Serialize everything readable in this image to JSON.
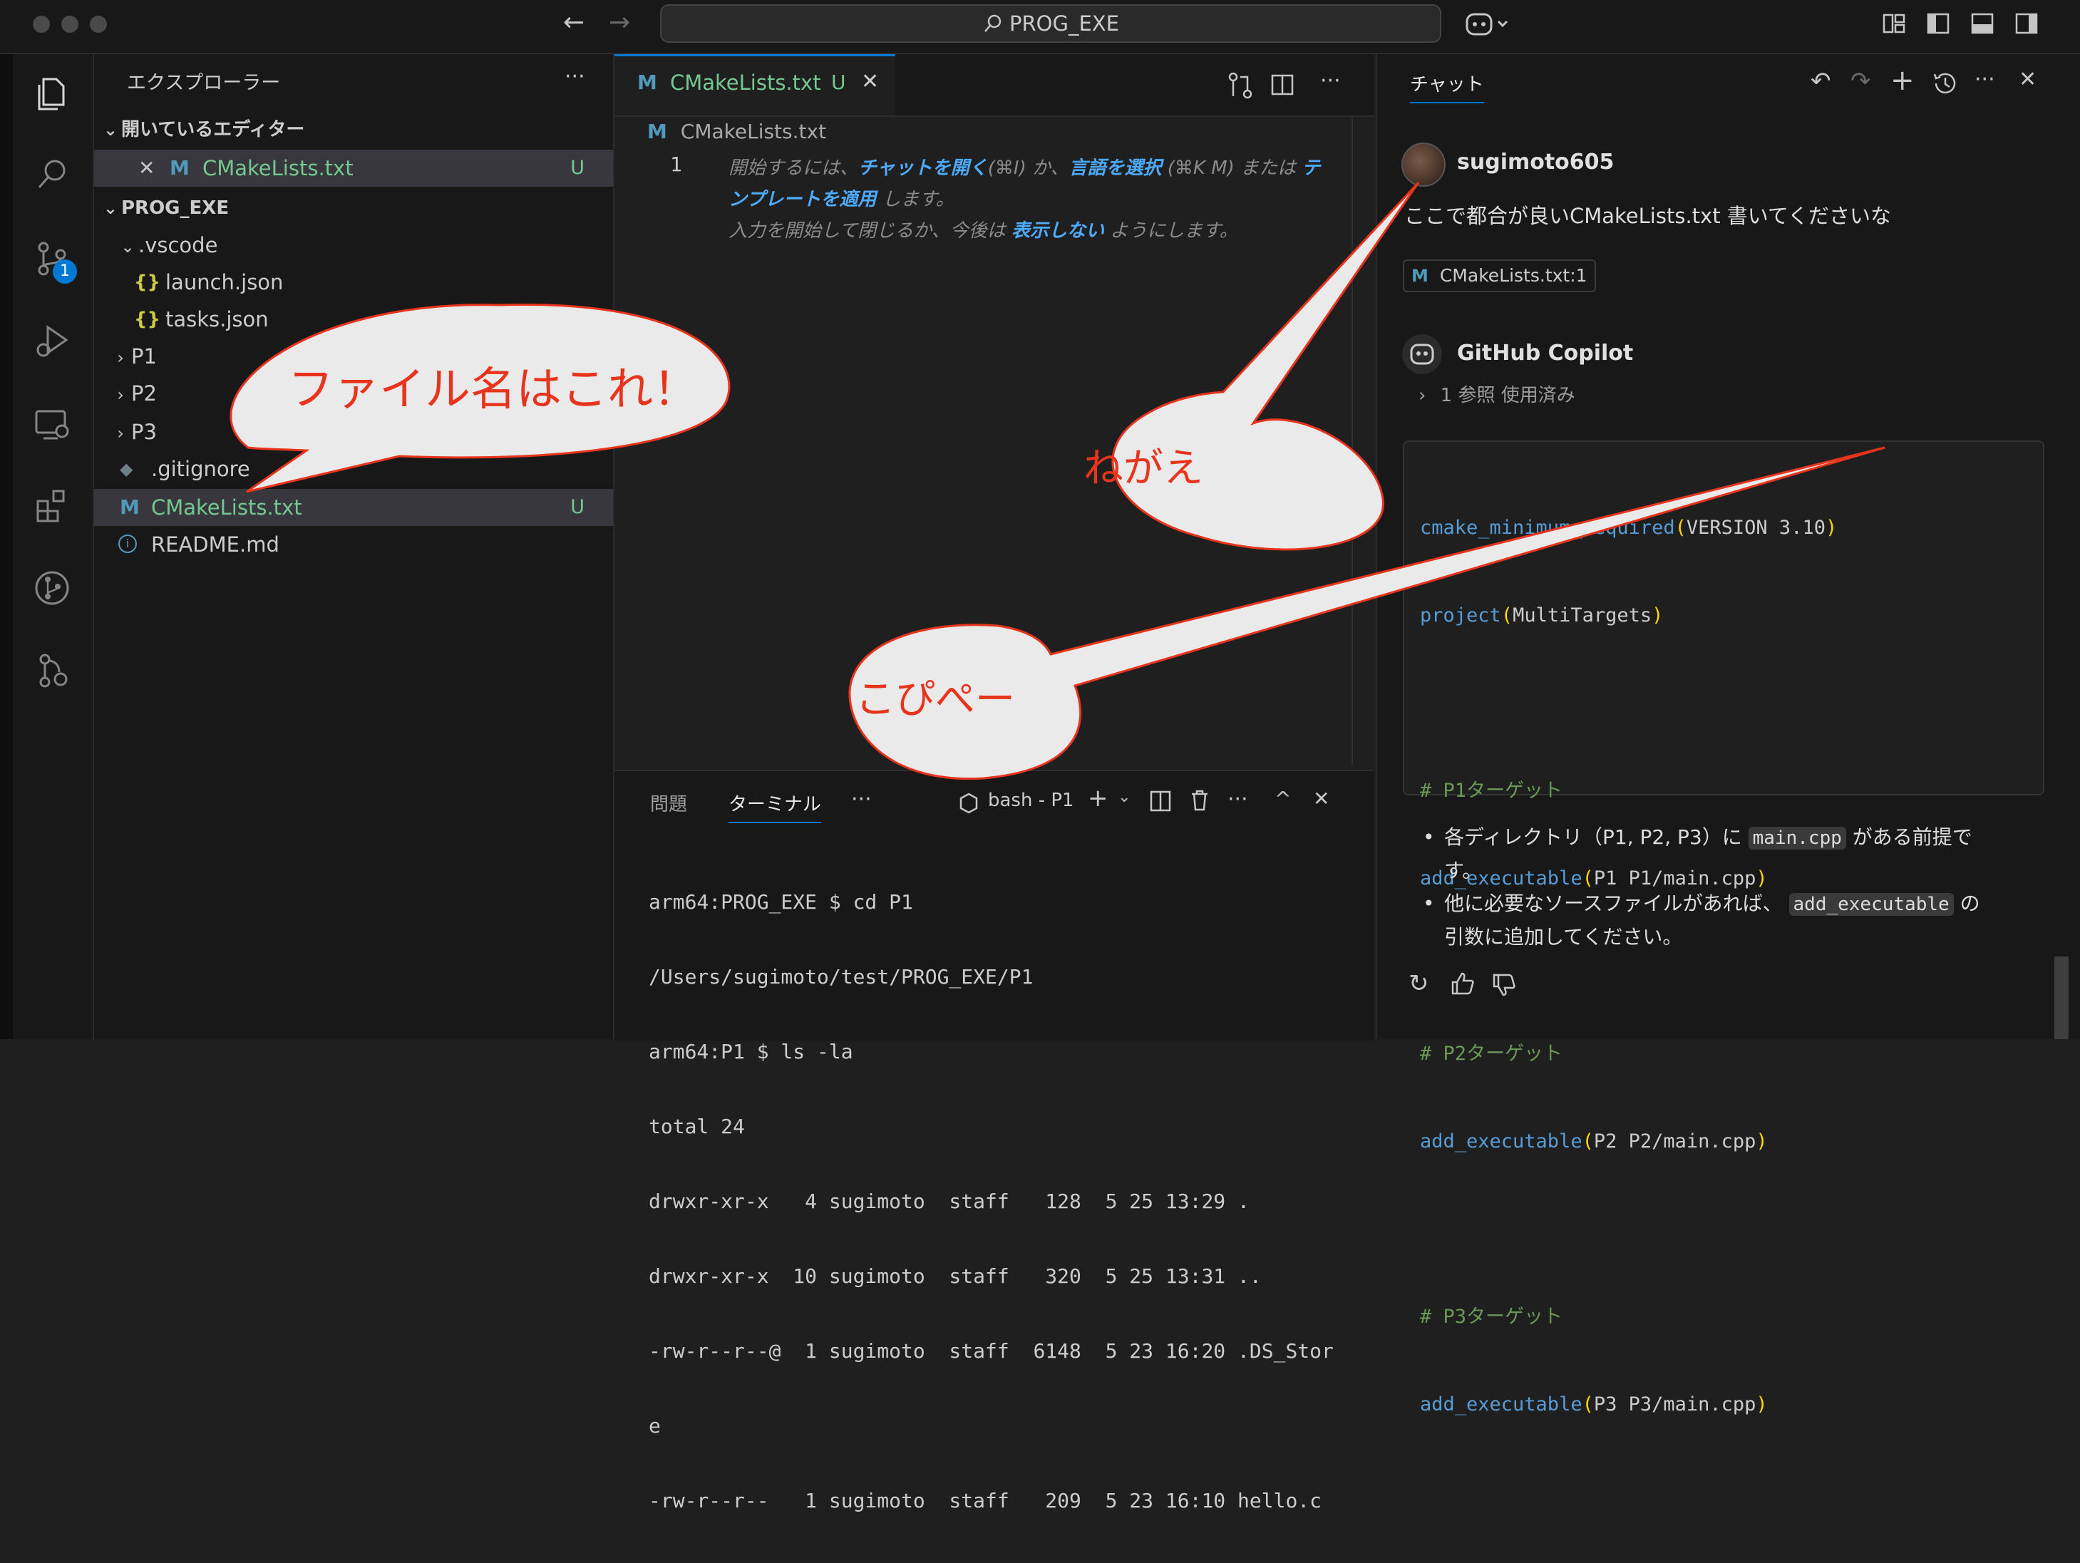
{
  "titlebar": {
    "search": "PROG_EXE"
  },
  "activity": {
    "scm_badge": "1"
  },
  "explorer": {
    "title": "エクスプローラー",
    "more": "···",
    "open_editors_title": "開いているエディター",
    "open_editor_file": "CMakeLists.txt",
    "open_editor_status": "U",
    "project_title": "PROG_EXE",
    "tree": {
      "vscode": ".vscode",
      "launch": "launch.json",
      "tasks": "tasks.json",
      "p1": "P1",
      "p2": "P2",
      "p3": "P3",
      "gitignore": ".gitignore",
      "cmake": "CMakeLists.txt",
      "cmake_status": "U",
      "readme": "README.md"
    },
    "json_glyph": "{}",
    "md_glyph": "M",
    "info_glyph": "i"
  },
  "editor": {
    "tab_label": "CMakeLists.txt",
    "tab_status": "U",
    "breadcrumb": "CMakeLists.txt",
    "line_number": "1",
    "hint": {
      "start": "開始するには、",
      "open_chat": "チャットを開く",
      "open_chat_key": "(⌘I)",
      "or": "か、",
      "select_lang": "言語を選択",
      "select_lang_key": "(⌘K M)",
      "or2": "または",
      "apply_template_1": "テ",
      "apply_template_2": "ンプレートを適用",
      "do": "します。",
      "line3_a": "入力を開始して閉じるか、今後は",
      "dont_show": "表示しない",
      "line3_b": "ようにします。"
    }
  },
  "panel": {
    "tab_problems": "問題",
    "tab_terminal": "ターミナル",
    "more": "···",
    "terminal_name": "bash - P1",
    "terminal_lines": [
      "arm64:PROG_EXE $ cd P1",
      "/Users/sugimoto/test/PROG_EXE/P1",
      "arm64:P1 $ ls -la",
      "total 24",
      "drwxr-xr-x   4 sugimoto  staff   128  5 25 13:29 .",
      "drwxr-xr-x  10 sugimoto  staff   320  5 25 13:31 ..",
      "-rw-r--r--@  1 sugimoto  staff  6148  5 23 16:20 .DS_Stor",
      "e",
      "-rw-r--r--   1 sugimoto  staff   209  5 23 16:10 hello.c"
    ]
  },
  "chat": {
    "tab": "チャット",
    "user_name": "sugimoto605",
    "user_message": "ここで都合が良いCMakeLists.txt 書いてくださいな",
    "attachment": "CMakeLists.txt:1",
    "bot_name": "GitHub Copilot",
    "references": "1 参照 使用済み",
    "code": {
      "l1_fn": "cmake_minimum_required",
      "l1_arg": "VERSION 3.10",
      "l2_fn": "project",
      "l2_arg": "MultiTargets",
      "c1": "# P1ターゲット",
      "l4_fn": "add_executable",
      "l4_arg": "P1 P1/main.cpp",
      "c2": "# P2ターゲット",
      "l6_fn": "add_executable",
      "l6_arg": "P2 P2/main.cpp",
      "c3": "# P3ターゲット",
      "l8_fn": "add_executable",
      "l8_arg": "P3 P3/main.cpp"
    },
    "bullet1_a": "各ディレクトリ（P1, P2, P3）に",
    "bullet1_code": "main.cpp",
    "bullet1_b": "がある前提で",
    "bullet1_c": "す。",
    "bullet2_a": "他に必要なソースファイルがあれば、",
    "bullet2_code": "add_executable",
    "bullet2_b": "の",
    "bullet2_c": "引数に追加してください。"
  },
  "annotations": {
    "bubble1": "ファイル名はこれ！",
    "bubble2": "ねがえ",
    "bubble3": "こぴぺー"
  },
  "colors": {
    "accent": "#0078d4",
    "untracked": "#73c991",
    "annotation_red": "#e8341c",
    "annotation_fill": "#eaeaea"
  }
}
